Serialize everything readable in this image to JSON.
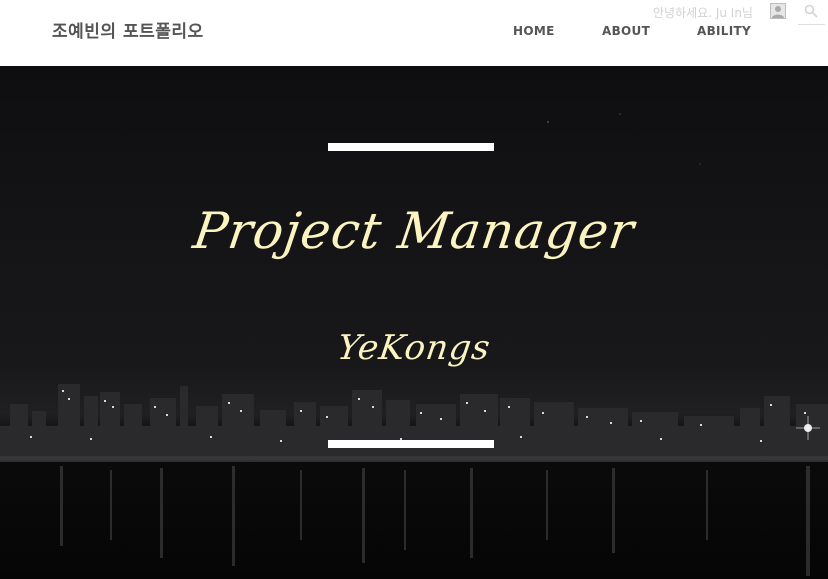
{
  "site": {
    "title": "조예빈의 포트폴리오",
    "greeting": "안녕하세요. Ju In님",
    "avatar_icon": "user-avatar-icon",
    "search_icon": "search-icon"
  },
  "nav": {
    "items": [
      {
        "label": "HOME"
      },
      {
        "label": "ABOUT"
      },
      {
        "label": "ABILITY"
      }
    ]
  },
  "hero": {
    "headline": "Project Manager",
    "subline": "YeKongs",
    "background": "night city skyline reflected on water",
    "text_color": "#fbf4c0",
    "accent_bar_color": "#ffffff"
  }
}
